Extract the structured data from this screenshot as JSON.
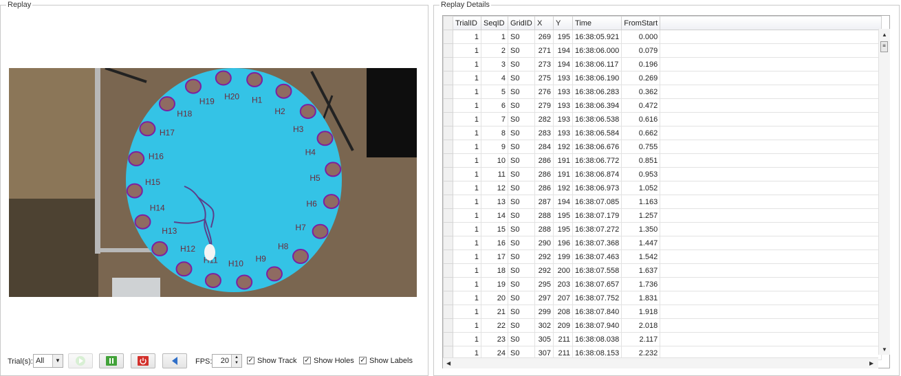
{
  "replay": {
    "title": "Replay",
    "holes": [
      {
        "label": "H1"
      },
      {
        "label": "H2"
      },
      {
        "label": "H3"
      },
      {
        "label": "H4"
      },
      {
        "label": "H5"
      },
      {
        "label": "H6"
      },
      {
        "label": "H7"
      },
      {
        "label": "H8"
      },
      {
        "label": "H9"
      },
      {
        "label": "H10"
      },
      {
        "label": "H11"
      },
      {
        "label": "H12"
      },
      {
        "label": "H13"
      },
      {
        "label": "H14"
      },
      {
        "label": "H15"
      },
      {
        "label": "H16"
      },
      {
        "label": "H17"
      },
      {
        "label": "H18"
      },
      {
        "label": "H19"
      },
      {
        "label": "H20"
      }
    ],
    "colors": {
      "arena": "#34c3e6",
      "hole": "#8f6b62",
      "hole_ring": "#7d1fa0",
      "track": "#5b3f8a",
      "floor": "#7a6650"
    }
  },
  "controls": {
    "trials_label": "Trial(s):",
    "trials_value": "All",
    "fps_label": "FPS:",
    "fps_value": "20",
    "show_track": "Show Track",
    "show_holes": "Show Holes",
    "show_labels": "Show Labels",
    "icons": [
      "play-icon",
      "pause-icon",
      "power-icon",
      "step-back-icon"
    ]
  },
  "details": {
    "title": "Replay Details",
    "columns": [
      "TrialID",
      "SeqID",
      "GridID",
      "X",
      "Y",
      "Time",
      "FromStart"
    ],
    "rows": [
      [
        "1",
        "1",
        "S0",
        "269",
        "195",
        "16:38:05.921",
        "0.000"
      ],
      [
        "1",
        "2",
        "S0",
        "271",
        "194",
        "16:38:06.000",
        "0.079"
      ],
      [
        "1",
        "3",
        "S0",
        "273",
        "194",
        "16:38:06.117",
        "0.196"
      ],
      [
        "1",
        "4",
        "S0",
        "275",
        "193",
        "16:38:06.190",
        "0.269"
      ],
      [
        "1",
        "5",
        "S0",
        "276",
        "193",
        "16:38:06.283",
        "0.362"
      ],
      [
        "1",
        "6",
        "S0",
        "279",
        "193",
        "16:38:06.394",
        "0.472"
      ],
      [
        "1",
        "7",
        "S0",
        "282",
        "193",
        "16:38:06.538",
        "0.616"
      ],
      [
        "1",
        "8",
        "S0",
        "283",
        "193",
        "16:38:06.584",
        "0.662"
      ],
      [
        "1",
        "9",
        "S0",
        "284",
        "192",
        "16:38:06.676",
        "0.755"
      ],
      [
        "1",
        "10",
        "S0",
        "286",
        "191",
        "16:38:06.772",
        "0.851"
      ],
      [
        "1",
        "11",
        "S0",
        "286",
        "191",
        "16:38:06.874",
        "0.953"
      ],
      [
        "1",
        "12",
        "S0",
        "286",
        "192",
        "16:38:06.973",
        "1.052"
      ],
      [
        "1",
        "13",
        "S0",
        "287",
        "194",
        "16:38:07.085",
        "1.163"
      ],
      [
        "1",
        "14",
        "S0",
        "288",
        "195",
        "16:38:07.179",
        "1.257"
      ],
      [
        "1",
        "15",
        "S0",
        "288",
        "195",
        "16:38:07.272",
        "1.350"
      ],
      [
        "1",
        "16",
        "S0",
        "290",
        "196",
        "16:38:07.368",
        "1.447"
      ],
      [
        "1",
        "17",
        "S0",
        "292",
        "199",
        "16:38:07.463",
        "1.542"
      ],
      [
        "1",
        "18",
        "S0",
        "292",
        "200",
        "16:38:07.558",
        "1.637"
      ],
      [
        "1",
        "19",
        "S0",
        "295",
        "203",
        "16:38:07.657",
        "1.736"
      ],
      [
        "1",
        "20",
        "S0",
        "297",
        "207",
        "16:38:07.752",
        "1.831"
      ],
      [
        "1",
        "21",
        "S0",
        "299",
        "208",
        "16:38:07.840",
        "1.918"
      ],
      [
        "1",
        "22",
        "S0",
        "302",
        "209",
        "16:38:07.940",
        "2.018"
      ],
      [
        "1",
        "23",
        "S0",
        "305",
        "211",
        "16:38:08.038",
        "2.117"
      ],
      [
        "1",
        "24",
        "S0",
        "307",
        "211",
        "16:38:08.153",
        "2.232"
      ]
    ]
  }
}
